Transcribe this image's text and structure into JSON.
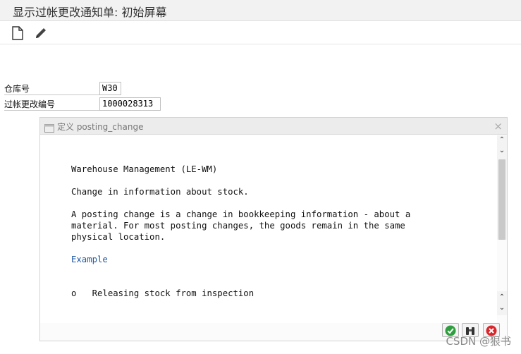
{
  "window": {
    "title": "显示过帐更改通知单: 初始屏幕"
  },
  "toolbar": {
    "buttons": [
      {
        "icon": "new-document-icon"
      },
      {
        "icon": "pencil-icon"
      }
    ]
  },
  "form": {
    "warehouse": {
      "label": "仓库号",
      "value": "W30"
    },
    "posting_change": {
      "label": "过帐更改编号",
      "value": "1000028313"
    }
  },
  "dialog": {
    "title": "定义 posting_change",
    "close_glyph": "×",
    "lines": {
      "heading": "Warehouse Management (LE-WM)",
      "summary": "Change in information about stock.",
      "body1": "A posting change is a change in bookkeeping information - about a",
      "body2": "material. For most posting changes, the goods remain in the same",
      "body3": "physical location.",
      "example_link": "Example",
      "bullet": "o   Releasing stock from inspection"
    },
    "buttons": [
      {
        "name": "confirm",
        "icon": "green-check-icon",
        "color": "#2e9e3e"
      },
      {
        "name": "find",
        "icon": "binoculars-icon"
      },
      {
        "name": "cancel",
        "icon": "red-cancel-icon",
        "color": "#d9262b"
      }
    ]
  },
  "watermark": "CSDN @狠书"
}
